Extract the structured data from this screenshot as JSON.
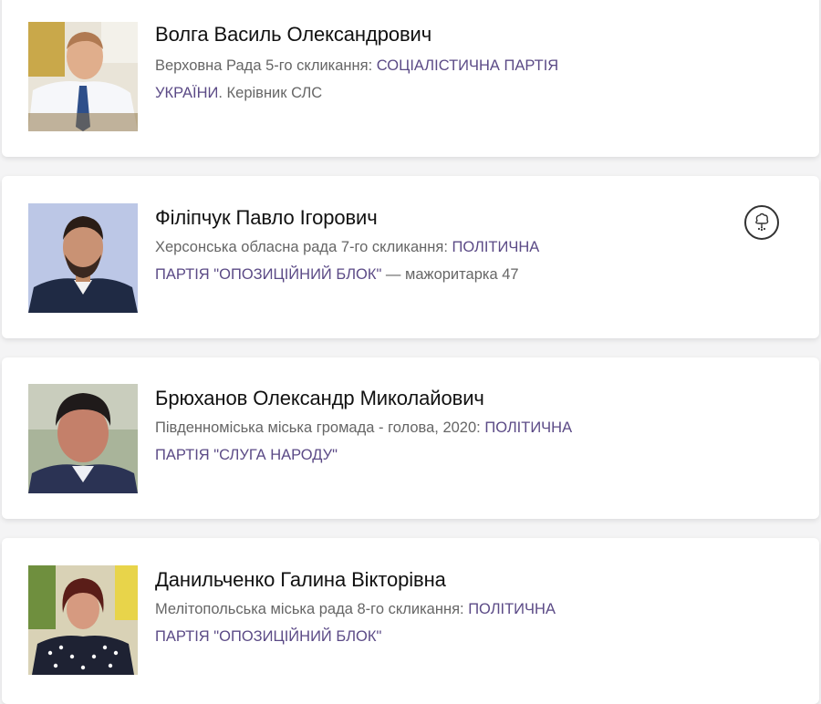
{
  "colors": {
    "background": "#f4f4f5",
    "card": "#ffffff",
    "name_text": "#111111",
    "description_text": "#666666",
    "party_link": "#5b4a86"
  },
  "people": [
    {
      "name": "Волга Василь Олександрович",
      "position": "Верховна Рада 5-го скликання: ",
      "party": "СОЦІАЛІСТИЧНА ПАРТІЯ УКРАЇНИ",
      "suffix": ". Керівник СЛС"
    },
    {
      "name": "Філіпчук Павло Ігорович",
      "position": "Херсонська обласна рада 7-го скликання: ",
      "party": "ПОЛІТИЧНА ПАРТІЯ \"ОПОЗИЦІЙНИЙ БЛОК\"",
      "suffix": " — мажоритарка 47",
      "badge_icon": "money-tree-icon"
    },
    {
      "name": "Брюханов Олександр Миколайович",
      "position": "Південноміська міська громада - голова, 2020: ",
      "party": "ПОЛІТИЧНА ПАРТІЯ \"СЛУГА НАРОДУ\"",
      "suffix": ""
    },
    {
      "name": "Данильченко Галина Вікторівна",
      "position": "Мелітопольська міська рада 8-го скликання: ",
      "party": "ПОЛІТИЧНА ПАРТІЯ \"ОПОЗИЦІЙНИЙ БЛОК\"",
      "suffix": ""
    }
  ]
}
